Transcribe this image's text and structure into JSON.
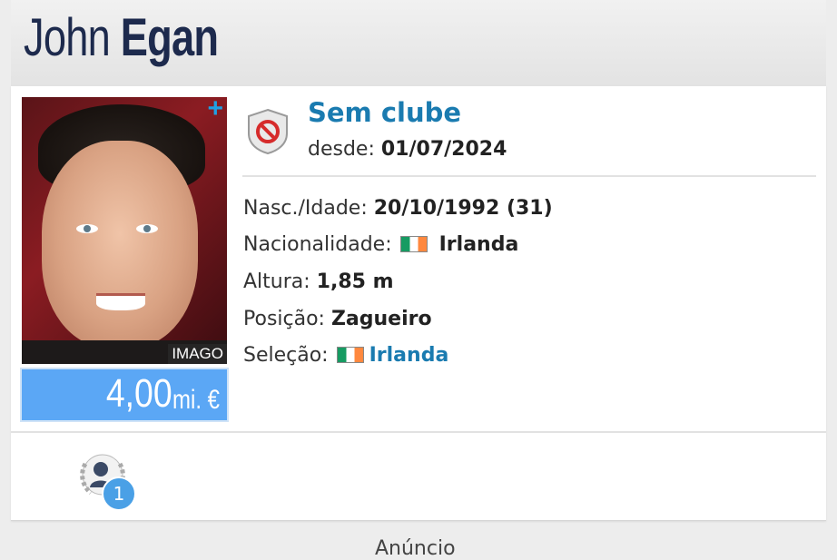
{
  "header": {
    "first_name": "John",
    "last_name": "Egan"
  },
  "photo": {
    "credit": "IMAGO",
    "plus_icon": "+"
  },
  "market_value": {
    "amount": "4,00",
    "unit": "mi. €",
    "color": "#5ba7f5"
  },
  "club": {
    "name": "Sem clube",
    "since_label": "desde:",
    "since_date": "01/07/2024",
    "icon": "no-club-shield-icon"
  },
  "info": {
    "birth_label": "Nasc./Idade:",
    "birth_value": "20/10/1992 (31)",
    "nationality_label": "Nacionalidade:",
    "nationality_value": "Irlanda",
    "height_label": "Altura:",
    "height_value": "1,85 m",
    "position_label": "Posição:",
    "position_value": "Zagueiro",
    "national_team_label": "Seleção:",
    "national_team_value": "Irlanda"
  },
  "awards": {
    "icon": "laurel-award-icon",
    "count": "1"
  },
  "ad": {
    "label": "Anúncio"
  },
  "colors": {
    "accent": "#1a7bb0",
    "name": "#1d2a4d",
    "badge": "#4aa0e6"
  }
}
